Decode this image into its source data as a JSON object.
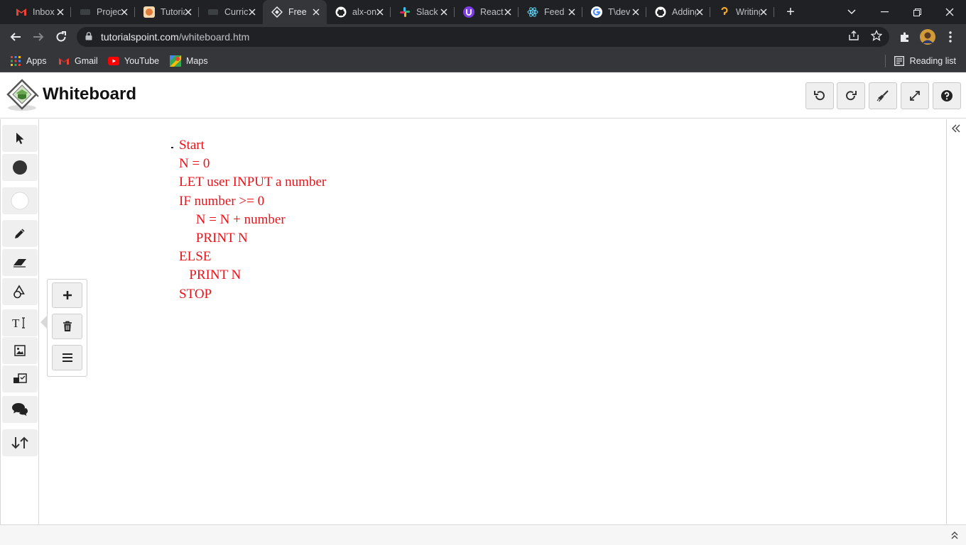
{
  "browser": {
    "tabs": [
      {
        "title": "Inbox",
        "favicon": "gmail-icon",
        "color": "#ea4335"
      },
      {
        "title": "Projects",
        "favicon": "project-icon",
        "color": "#5f6368"
      },
      {
        "title": "Tutorials",
        "favicon": "tutorials-icon",
        "color": "#e07b39"
      },
      {
        "title": "Curriculum",
        "favicon": "curriculum-icon",
        "color": "#5f6368"
      },
      {
        "title": "Free",
        "favicon": "whiteboard-icon",
        "color": "#9aa0a6"
      },
      {
        "title": "alx-online",
        "favicon": "github-icon",
        "color": "#ffffff"
      },
      {
        "title": "Slack",
        "favicon": "slack-icon",
        "color": "#e01e5a"
      },
      {
        "title": "React",
        "favicon": "react-u-icon",
        "color": "#7b3fe4"
      },
      {
        "title": "Feed",
        "favicon": "react-icon",
        "color": "#61dafb"
      },
      {
        "title": "T\\dev",
        "favicon": "google-icon",
        "color": "#4285f4"
      },
      {
        "title": "Adding",
        "favicon": "github-icon",
        "color": "#ffffff"
      },
      {
        "title": "Writing",
        "favicon": "question-icon",
        "color": "#f5a623"
      }
    ],
    "active_tab": 4,
    "url_domain": "tutorialspoint.com",
    "url_path": "/whiteboard.htm",
    "bookmarks": [
      {
        "label": "Apps",
        "icon": "apps-grid-icon"
      },
      {
        "label": "Gmail",
        "icon": "gmail-icon"
      },
      {
        "label": "YouTube",
        "icon": "youtube-icon"
      },
      {
        "label": "Maps",
        "icon": "maps-icon"
      }
    ],
    "reading_list": "Reading list"
  },
  "app": {
    "title": "Whiteboard"
  },
  "canvas": {
    "lines": [
      "Start",
      "N = 0",
      "LET user INPUT a number",
      "IF number >= 0",
      "     N = N + number",
      "     PRINT N",
      "ELSE",
      "   PRINT N",
      "STOP"
    ],
    "text_color": "#e8141b"
  }
}
